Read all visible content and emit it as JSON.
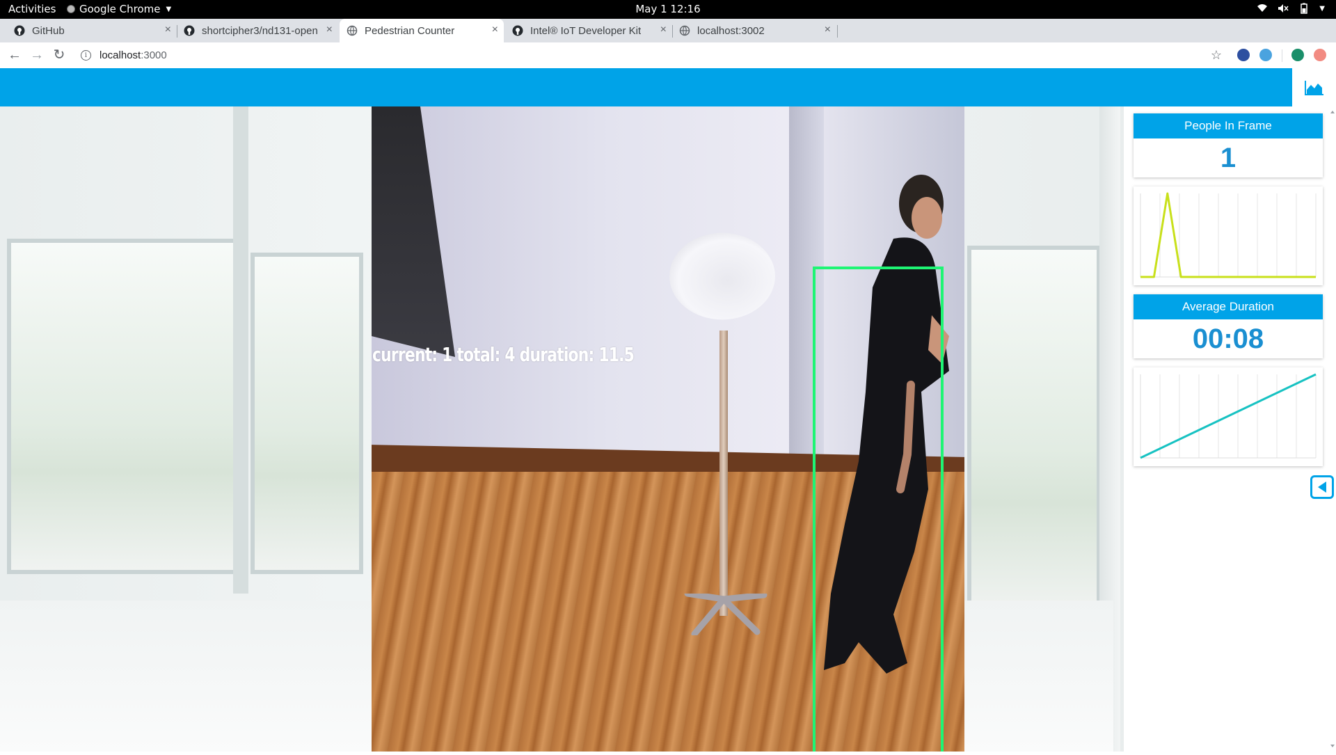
{
  "system_bar": {
    "activities": "Activities",
    "app_name": "Google Chrome",
    "clock": "May 1  12:16"
  },
  "browser": {
    "tabs": [
      {
        "title": "GitHub",
        "icon": "github-icon",
        "active": false
      },
      {
        "title": "shortcipher3/nd131-open",
        "icon": "github-icon",
        "active": false
      },
      {
        "title": "Pedestrian Counter",
        "icon": "globe-icon",
        "active": true
      },
      {
        "title": "Intel® IoT Developer Kit",
        "icon": "github-icon",
        "active": false
      },
      {
        "title": "localhost:3002",
        "icon": "globe-icon",
        "active": false
      }
    ],
    "new_tab": "+",
    "close_glyph": "×",
    "url_host": "localhost",
    "url_port": ":3000"
  },
  "video": {
    "overlay_text": "current: 1 total: 4 duration: 11.5"
  },
  "stats": {
    "people_in_frame": {
      "label": "People In Frame",
      "value": "1"
    },
    "average_duration": {
      "label": "Average Duration",
      "value": "00:08"
    }
  },
  "chart_data": [
    {
      "type": "line",
      "title": "",
      "series": [
        {
          "values": [
            0,
            0,
            1,
            0,
            0,
            0,
            0,
            0,
            0,
            0,
            0,
            0,
            0,
            0
          ]
        }
      ],
      "ylim": [
        0,
        1
      ],
      "grid": true,
      "color": "#c8e01a"
    },
    {
      "type": "line",
      "title": "",
      "series": [
        {
          "values": [
            0,
            1,
            2,
            3,
            4,
            5,
            6,
            7,
            8
          ]
        }
      ],
      "ylim": [
        0,
        8
      ],
      "grid": true,
      "color": "#17c2c2"
    }
  ],
  "colors": {
    "accent": "#00a3e8",
    "bbox": "#1ef574"
  }
}
